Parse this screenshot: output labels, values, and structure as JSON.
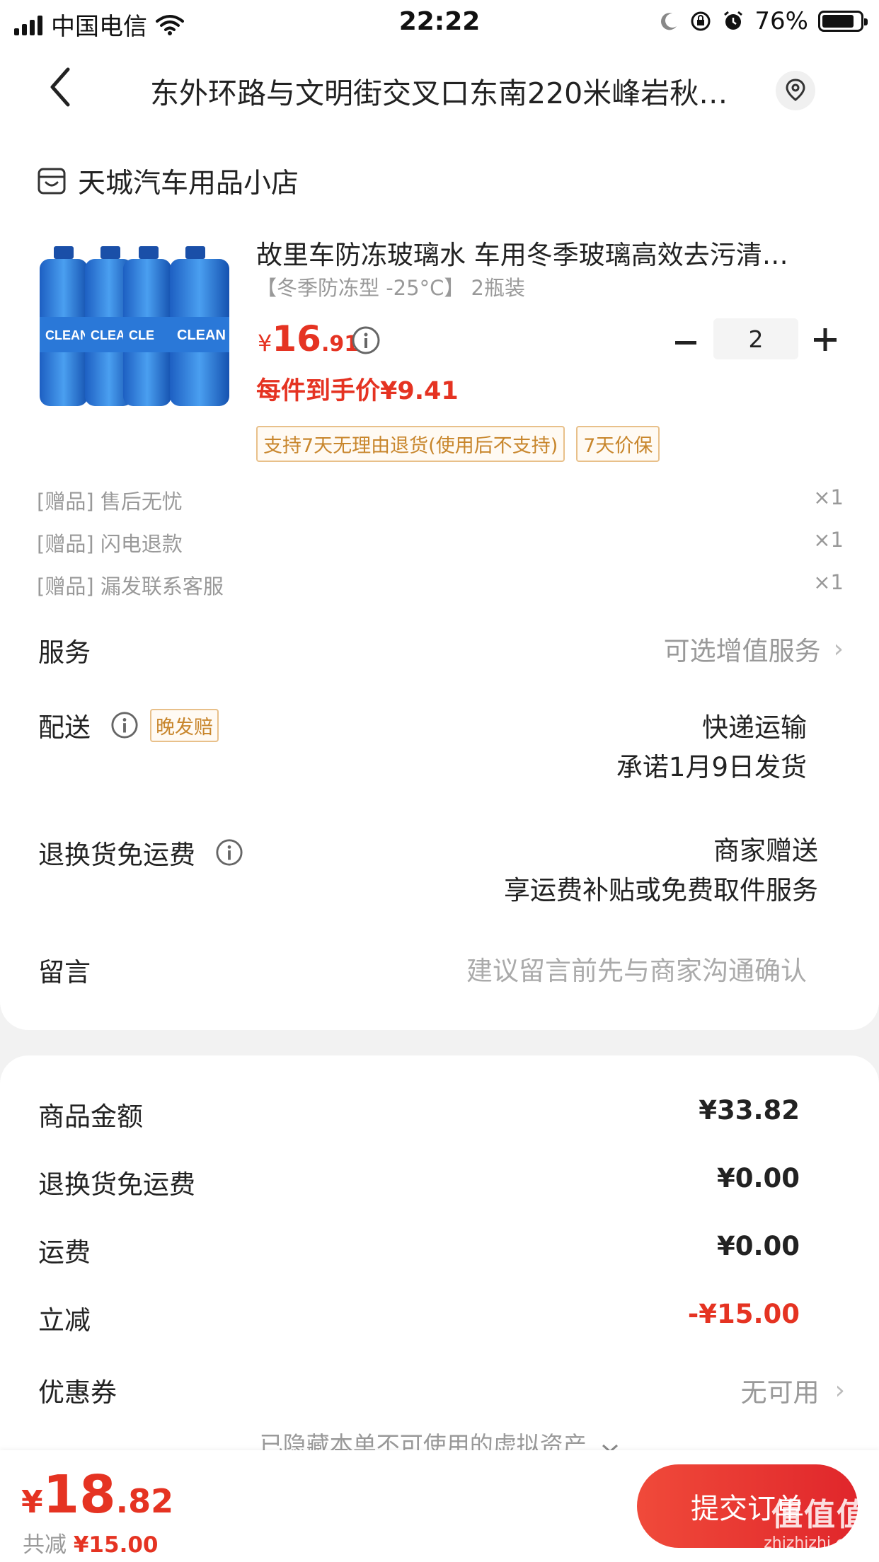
{
  "status_bar": {
    "carrier": "中国电信",
    "time": "22:22",
    "battery": "76%"
  },
  "nav": {
    "title": "东外环路与文明街交叉口东南220米峰岩秋…"
  },
  "shop": {
    "name": "天城汽车用品小店"
  },
  "product": {
    "title": "故里车防冻玻璃水 车用冬季玻璃高效去污清…",
    "spec": "【冬季防冻型 -25°C】 2瓶装",
    "price_currency": "¥",
    "price_int": "16",
    "price_dec": ".91",
    "quantity": "2",
    "unit_price_text": "每件到手价¥9.41",
    "tags": [
      "支持7天无理由退货(使用后不支持)",
      "7天价保"
    ],
    "image_label": "CLEAN"
  },
  "gifts": [
    {
      "label": "[赠品] 售后无忧",
      "qty": "×1"
    },
    {
      "label": "[赠品] 闪电退款",
      "qty": "×1"
    },
    {
      "label": "[赠品] 漏发联系客服",
      "qty": "×1"
    }
  ],
  "service": {
    "label": "服务",
    "value": "可选增值服务"
  },
  "delivery": {
    "label": "配送",
    "badge": "晚发赔",
    "method": "快递运输",
    "promise": "承诺1月9日发货"
  },
  "return_shipping": {
    "label": "退换货免运费",
    "value1": "商家赠送",
    "value2": "享运费补贴或免费取件服务"
  },
  "message": {
    "label": "留言",
    "placeholder": "建议留言前先与商家沟通确认"
  },
  "summary": {
    "goods_label": "商品金额",
    "goods_value": "¥33.82",
    "return_label": "退换货免运费",
    "return_value": "¥0.00",
    "shipping_label": "运费",
    "shipping_value": "¥0.00",
    "discount_label": "立减",
    "discount_value": "-¥15.00",
    "coupon_label": "优惠券",
    "coupon_value": "无可用",
    "hidden_assets": "已隐藏本单不可使用的虚拟资产"
  },
  "bottom": {
    "currency": "¥",
    "total_int": "18",
    "total_dec": ".82",
    "saved_label": "共减",
    "saved_amount": "¥15.00",
    "submit": "提交订单"
  },
  "watermark": {
    "logo": "值值值",
    "site": "zhizhizhi.com"
  },
  "colors": {
    "accent_red": "#e53322",
    "tag_orange": "#c8862c"
  }
}
